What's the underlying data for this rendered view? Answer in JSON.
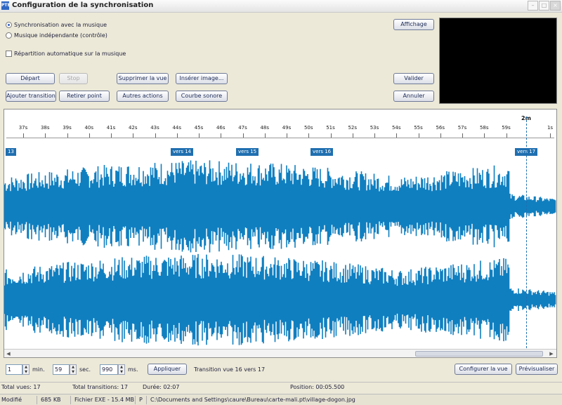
{
  "window": {
    "title": "Configuration de la synchronisation",
    "app_icon": "PTE",
    "minimize": "–",
    "maximize": "□",
    "close": "×"
  },
  "options": {
    "sync_music": "Synchronisation avec la musique",
    "independent_music": "Musique indépendante (contrôle)",
    "auto_distribution": "Répartition automatique sur la musique"
  },
  "buttons": {
    "depart": "Départ",
    "stop": "Stop",
    "supprimer_vue": "Supprimer la vue",
    "inserer_image": "Insérer image...",
    "ajouter_transition": "Ajouter transition",
    "retirer_point": "Retirer point",
    "autres_actions": "Autres actions",
    "courbe_sonore": "Courbe sonore",
    "affichage": "Affichage",
    "valider": "Valider",
    "annuler": "Annuler",
    "appliquer": "Appliquer",
    "configurer_vue": "Configurer la vue",
    "previsualiser": "Prévisualiser"
  },
  "timeline": {
    "ticks": [
      "37s",
      "38s",
      "39s",
      "40s",
      "41s",
      "42s",
      "43s",
      "44s",
      "45s",
      "46s",
      "47s",
      "48s",
      "49s",
      "50s",
      "51s",
      "52s",
      "53s",
      "54s",
      "55s",
      "56s",
      "57s",
      "58s",
      "59s",
      "1s"
    ],
    "cursor_label": "2m",
    "markers": [
      "13",
      "vers 14",
      "vers 15",
      "vers 16",
      "vers 17"
    ],
    "wave_color": "#0f7fc0"
  },
  "time_fields": {
    "min_value": "1",
    "min_unit": "min.",
    "sec_value": "59",
    "sec_unit": "sec.",
    "ms_value": "990",
    "ms_unit": "ms."
  },
  "transition_info": "Transition vue 16 vers 17",
  "status": {
    "total_vues": "Total vues: 17",
    "total_transitions": "Total transitions: 17",
    "duree": "Durée: 02:07",
    "position": "Position: 00:05.500"
  },
  "taskbar": {
    "modifie": "Modifié",
    "size": "685 KB",
    "file_type": "Fichier EXE - 15.4 MB",
    "p": "P",
    "path": "C:\\Documents and Settings\\caure\\Bureau\\carte-mali.pt\\village-dogon.jpg"
  }
}
